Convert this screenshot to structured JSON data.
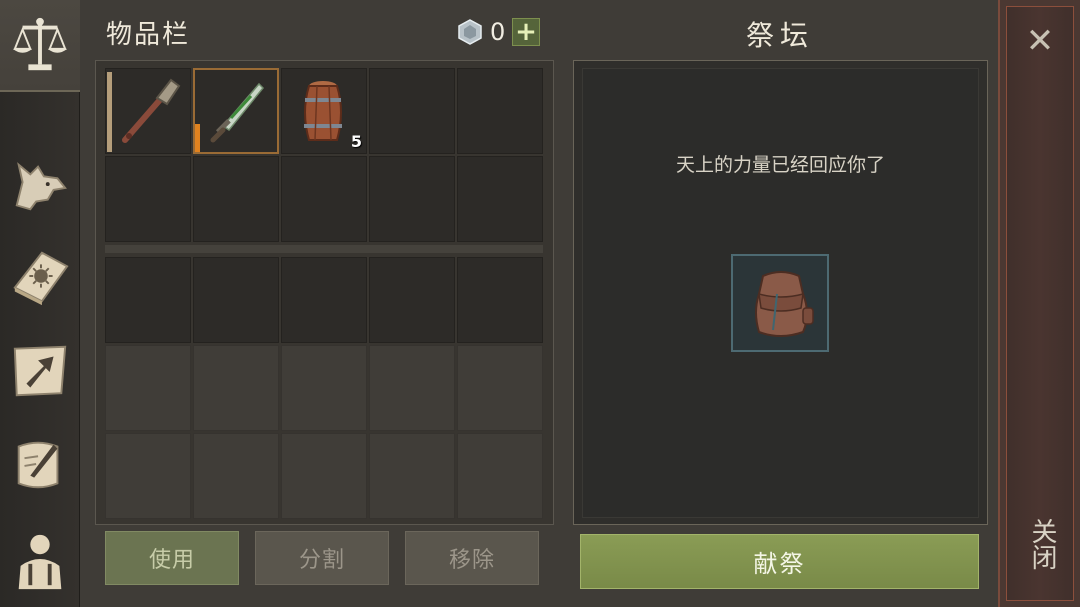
{
  "sidebar": {
    "tabs": [
      {
        "name": "scales-icon",
        "active": true
      },
      {
        "name": "wolf-icon",
        "active": false
      },
      {
        "name": "sun-book-icon",
        "active": false
      },
      {
        "name": "map-arrow-icon",
        "active": false
      },
      {
        "name": "scroll-quill-icon",
        "active": false
      },
      {
        "name": "character-icon",
        "active": false
      }
    ]
  },
  "inventory": {
    "title": "物品栏",
    "currency": {
      "icon": "gem-icon",
      "value": "0",
      "plus": "+"
    },
    "slots": [
      {
        "item": "club-icon",
        "count": "",
        "durability": 1.0,
        "durability_color": "#b59e7b",
        "selected": false
      },
      {
        "item": "dagger-icon",
        "count": "",
        "durability": 0.35,
        "durability_color": "#e0821f",
        "selected": true
      },
      {
        "item": "barrel-icon",
        "count": "5",
        "durability": null,
        "selected": false
      }
    ],
    "buttons": {
      "use": "使用",
      "split": "分割",
      "remove": "移除"
    }
  },
  "altar": {
    "title": "祭坛",
    "message": "天上的力量已经回应你了",
    "offer_item": "backpack-icon",
    "sacrifice_label": "献祭"
  },
  "close": {
    "symbol": "✕",
    "label": "关闭"
  },
  "colors": {
    "accent_green": "#798a48",
    "close_red": "#8c4f3c",
    "durability_orange": "#e0821f"
  }
}
